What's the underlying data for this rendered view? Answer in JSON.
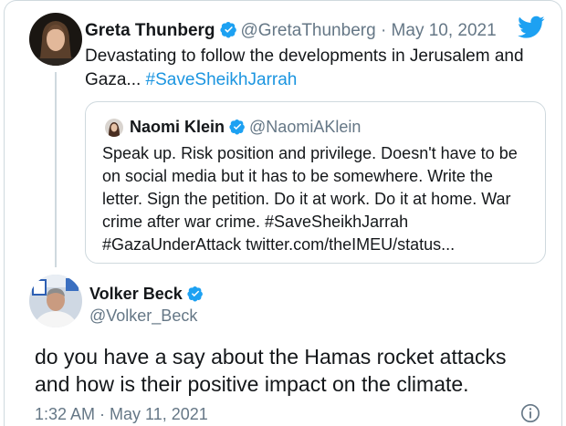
{
  "brand": {
    "accent": "#1da1f2",
    "link": "#1b95e0",
    "muted": "#657786",
    "border": "#cfd9de"
  },
  "tweet": {
    "author_name": "Greta Thunberg",
    "author_handle": "@GretaThunberg",
    "separator": "·",
    "date": "May 10, 2021",
    "text_plain": "Devastating to follow the developments in Jerusalem and Gaza...",
    "hashtag": "#SaveSheikhJarrah",
    "avatar_icon": "avatar-photo",
    "verified_icon": "verified-badge-icon",
    "logo_icon": "twitter-bird-icon"
  },
  "quoted": {
    "author_name": "Naomi Klein",
    "author_handle": "@NaomiAKlein",
    "text": "Speak up. Risk position and privilege. Doesn't have to be on social media but it has to be somewhere. Write the letter. Sign the petition. Do it at work. Do it at home. War crime after war crime. #SaveSheikhJarrah #GazaUnderAttack twitter.com/theIMEU/status..."
  },
  "reply": {
    "author_name": "Volker Beck",
    "author_handle": "@Volker_Beck",
    "text": "do you have a say about the Hamas rocket attacks and how is their positive impact on the climate.",
    "timestamp": "1:32 AM · May 11, 2021",
    "info_icon": "info-icon"
  }
}
